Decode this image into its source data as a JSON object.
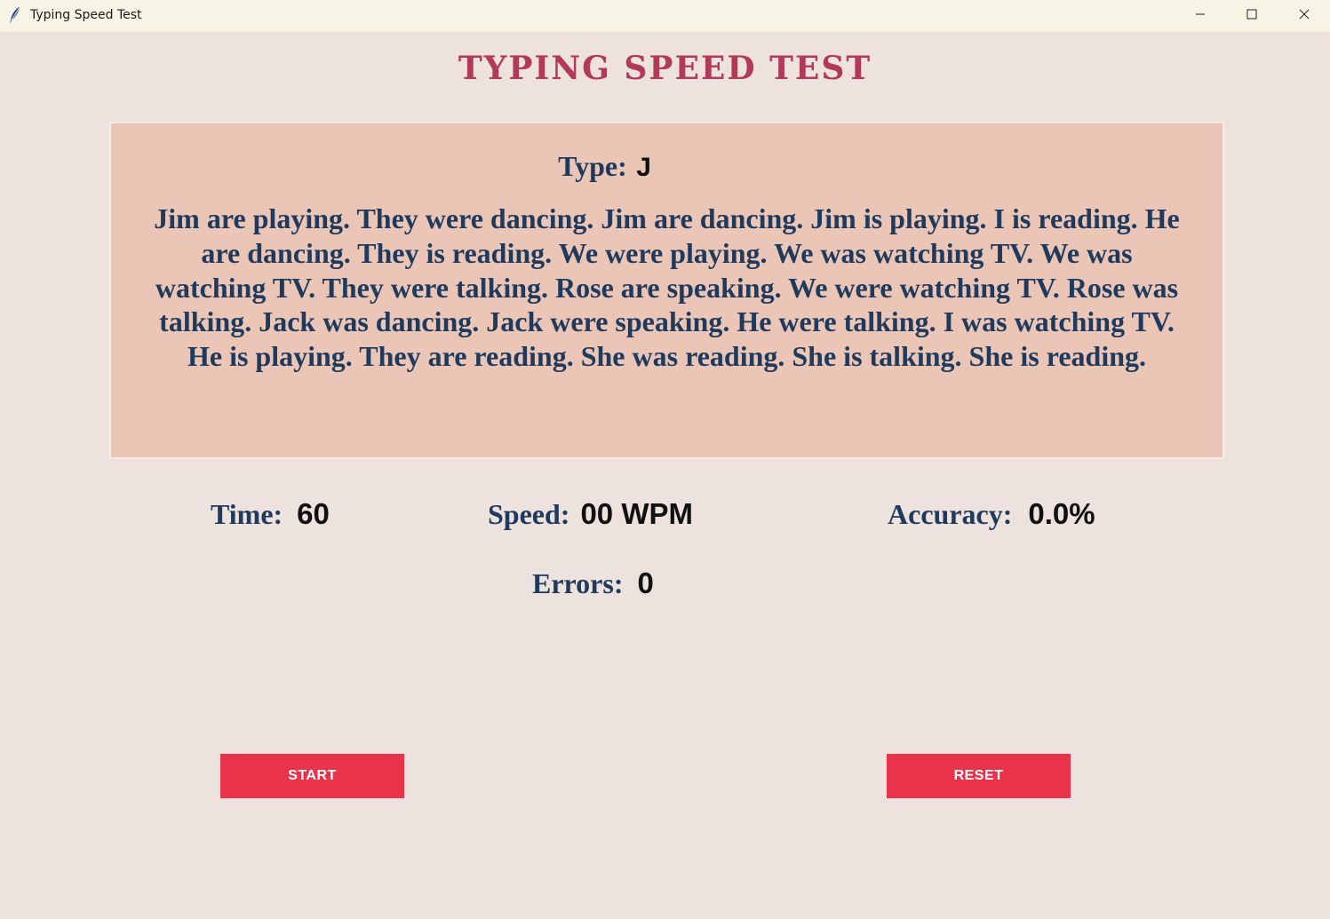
{
  "window": {
    "title": "Typing Speed Test",
    "app_icon": "feather-icon",
    "controls": [
      "minimize-icon",
      "maximize-icon",
      "close-icon"
    ]
  },
  "header": {
    "title": "TYPING SPEED TEST"
  },
  "prompt": {
    "type_label": "Type:",
    "current_char": "J",
    "passage": "Jim are playing. They were dancing. Jim are dancing. Jim is playing. I is reading. He are dancing. They is reading. We were playing. We was watching TV. We was watching TV. They were talking. Rose are speaking. We were watching TV. Rose was talking. Jack was dancing. Jack were speaking. He were talking. I was watching TV. He is playing. They are reading. She was reading. She is talking. She is reading."
  },
  "stats": {
    "time_label": "Time:",
    "time_value": "60",
    "speed_label": "Speed:",
    "speed_value": "00 WPM",
    "accuracy_label": "Accuracy:",
    "accuracy_value": "0.0%",
    "errors_label": "Errors:",
    "errors_value": "0"
  },
  "buttons": {
    "start_label": "START",
    "reset_label": "RESET"
  },
  "colors": {
    "background": "#ede2dd",
    "titlebar": "#f5f4e5",
    "title": "#b3395a",
    "panel": "#ebc6b7",
    "text": "#1f3a5c",
    "button": "#e8334a"
  }
}
